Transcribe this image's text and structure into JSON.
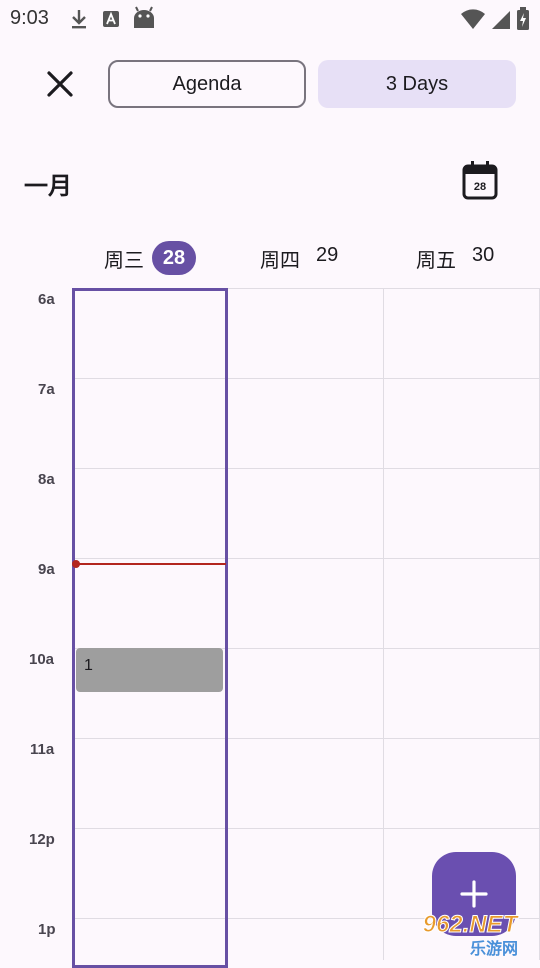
{
  "status_bar": {
    "time": "9:03",
    "left_icons": [
      "download-icon",
      "font-app-icon",
      "android-icon"
    ],
    "right_icons": [
      "wifi-icon",
      "signal-icon",
      "battery-charging-icon"
    ]
  },
  "toolbar": {
    "close_icon": "close-icon",
    "view_tabs": [
      {
        "label": "Agenda",
        "selected": false
      },
      {
        "label": "3 Days",
        "selected": true
      }
    ]
  },
  "header": {
    "month": "一月",
    "calendar_icon_day": "28"
  },
  "days": [
    {
      "weekday": "周三",
      "date": "28",
      "today": true
    },
    {
      "weekday": "周四",
      "date": "29",
      "today": false
    },
    {
      "weekday": "周五",
      "date": "30",
      "today": false
    }
  ],
  "hours": [
    "6a",
    "7a",
    "8a",
    "9a",
    "10a",
    "11a",
    "12p",
    "1p"
  ],
  "events": [
    {
      "title": "1",
      "day": "周三",
      "start": "10a"
    }
  ],
  "fab": {
    "icon": "plus-icon"
  },
  "watermark": {
    "text_top": "962.NET",
    "text_bottom": "乐游网"
  },
  "colors": {
    "accent": "#6750a4",
    "selected_tab_bg": "#e7e0f6",
    "now_indicator": "#b3261e",
    "event_bg": "#9e9e9e",
    "background": "#fdf8fd"
  }
}
